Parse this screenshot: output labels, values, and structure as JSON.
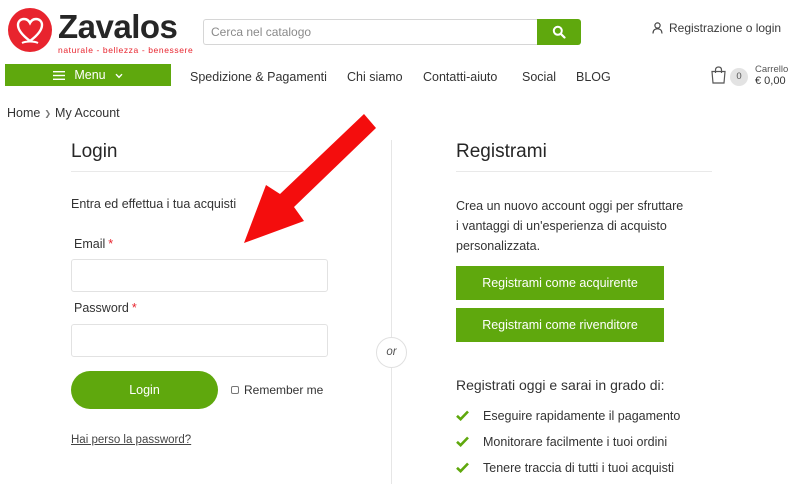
{
  "brand": {
    "name": "Zavalos",
    "tagline": "naturale - bellezza - benessere",
    "color_red": "#e8242e",
    "color_green": "#5fa80d"
  },
  "header": {
    "search_placeholder": "Cerca nel catalogo",
    "account_link": "Registrazione o login",
    "cart_label": "Carrello",
    "cart_count": "0",
    "cart_total": "€ 0,00"
  },
  "nav": {
    "menu_label": "Menu",
    "items": [
      "Spedizione & Pagamenti",
      "Chi siamo",
      "Contatti-aiuto",
      "Social",
      "BLOG"
    ]
  },
  "breadcrumb": {
    "home": "Home",
    "current": "My Account"
  },
  "login": {
    "title": "Login",
    "intro": "Entra ed effettua i tua acquisti",
    "email_label": "Email",
    "password_label": "Password",
    "required_mark": "*",
    "button": "Login",
    "remember": "Remember me",
    "lost_password": "Hai perso la password?"
  },
  "divider_label": "or",
  "register": {
    "title": "Registrami",
    "description_lines": [
      "Crea un nuovo account oggi per sfruttare",
      "i vantaggi di un'esperienza di acquisto",
      "personalizzata."
    ],
    "buyer_button": "Registrami come acquirente",
    "reseller_button": "Registrami come rivenditore",
    "benefits_title": "Registrati oggi e sarai in grado di:",
    "benefits": [
      "Eseguire rapidamente il pagamento",
      "Monitorare facilmente i tuoi ordini",
      "Tenere traccia di tutti i tuoi acquisti"
    ]
  },
  "icons": {
    "logo": "heart-leaf-logo-icon",
    "search": "search-icon",
    "account": "user-icon",
    "menu": "hamburger-icon",
    "dropdown": "chevron-down-icon",
    "cart": "shopping-bag-icon",
    "breadcrumb_separator": "chevron-right-icon",
    "benefit": "check-icon",
    "annotation": "red-arrow-icon"
  }
}
